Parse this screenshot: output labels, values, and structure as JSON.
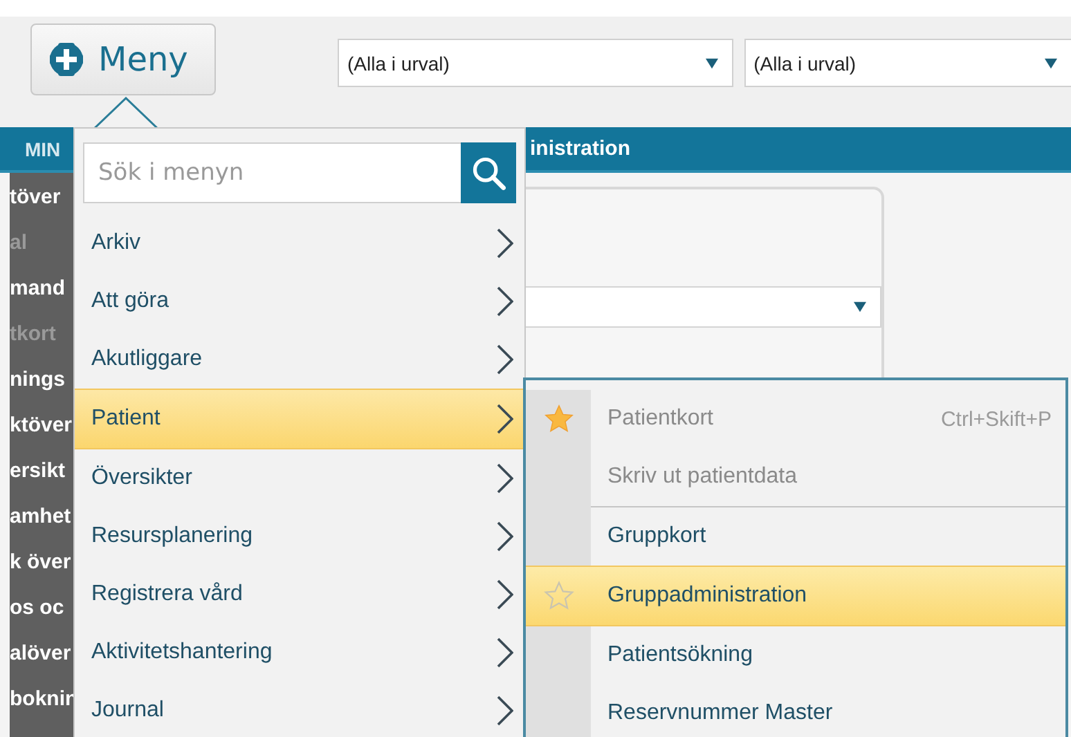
{
  "menu_button": {
    "label": "Meny"
  },
  "filters": [
    {
      "value": "(Alla i urval)"
    },
    {
      "value": "(Alla i urval)"
    }
  ],
  "header_bar": {
    "left_text": "MIN",
    "title": "inistration"
  },
  "sidebar": {
    "items": [
      {
        "label": "töver",
        "disabled": false
      },
      {
        "label": "al",
        "disabled": true
      },
      {
        "label": "mand",
        "disabled": false
      },
      {
        "label": "tkort",
        "disabled": true
      },
      {
        "label": "nings",
        "disabled": false
      },
      {
        "label": "ktöver",
        "disabled": false
      },
      {
        "label": "ersikt",
        "disabled": false
      },
      {
        "label": "amhet",
        "disabled": false
      },
      {
        "label": "k över",
        "disabled": false
      },
      {
        "label": "os oc",
        "disabled": false
      },
      {
        "label": "alöver",
        "disabled": false
      },
      {
        "label": "boknin",
        "disabled": false
      }
    ]
  },
  "menu": {
    "search": {
      "placeholder": "Sök i menyn"
    },
    "items": [
      {
        "label": "Arkiv",
        "selected": false
      },
      {
        "label": "Att göra",
        "selected": false
      },
      {
        "label": "Akutliggare",
        "selected": false
      },
      {
        "label": "Patient",
        "selected": true
      },
      {
        "label": "Översikter",
        "selected": false
      },
      {
        "label": "Resursplanering",
        "selected": false
      },
      {
        "label": "Registrera vård",
        "selected": false
      },
      {
        "label": "Aktivitetshantering",
        "selected": false
      },
      {
        "label": "Journal",
        "selected": false
      }
    ]
  },
  "submenu": {
    "items": [
      {
        "label": "Patientkort",
        "shortcut": "Ctrl+Skift+P",
        "disabled": true,
        "selected": false,
        "favorite": true,
        "separator_after": false
      },
      {
        "label": "Skriv ut patientdata",
        "disabled": true,
        "selected": false,
        "favorite": false,
        "separator_after": true
      },
      {
        "label": "Gruppkort",
        "disabled": false,
        "selected": false,
        "favorite": false,
        "separator_after": false
      },
      {
        "label": "Gruppadministration",
        "disabled": false,
        "selected": true,
        "favorite": false,
        "separator_after": false
      },
      {
        "label": "Patientsökning",
        "disabled": false,
        "selected": false,
        "favorite": false,
        "separator_after": false
      },
      {
        "label": "Reservnummer Master",
        "disabled": false,
        "selected": false,
        "favorite": false,
        "separator_after": false
      }
    ]
  }
}
